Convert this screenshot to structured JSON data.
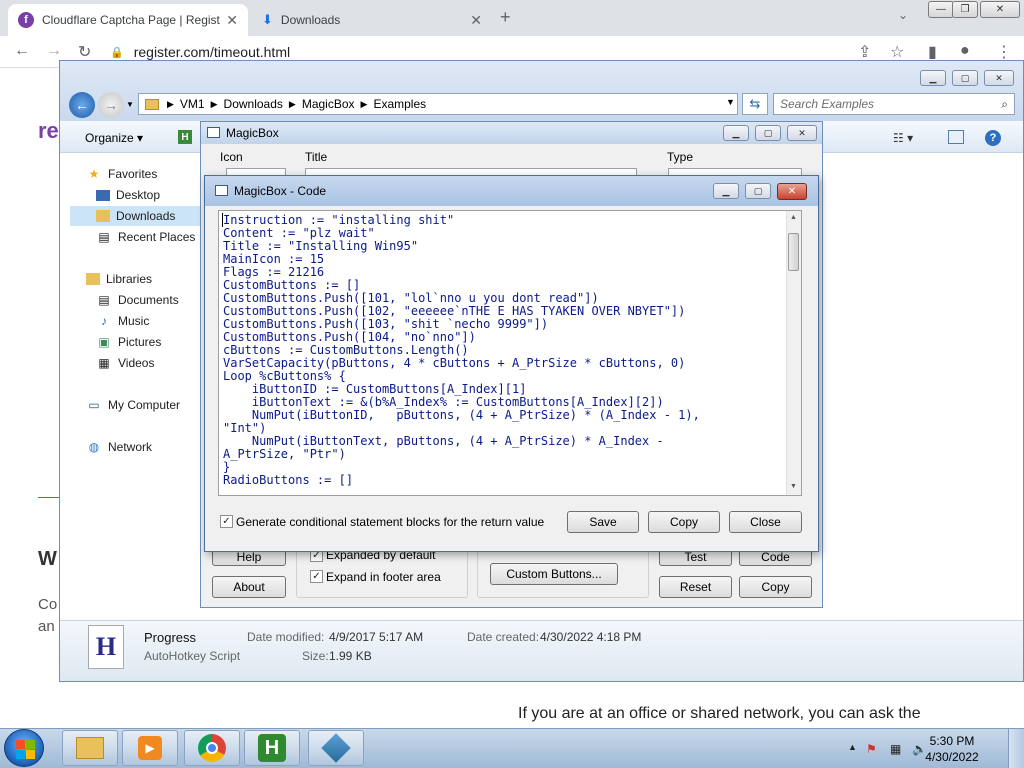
{
  "browser": {
    "tabs": [
      {
        "title": "Cloudflare Captcha Page | Regist",
        "favicon": "f"
      },
      {
        "title": "Downloads",
        "favicon": "download-arrow"
      }
    ],
    "new_tab": "+",
    "url": "register.com/timeout.html"
  },
  "webpage": {
    "logo_fragment": "re",
    "heading_fragment": "W",
    "line1_fragment": "Co",
    "line2_fragment": "an",
    "bottom_text": "If you are at an office or shared network, you can ask the"
  },
  "explorer": {
    "breadcrumb": [
      "VM1",
      "Downloads",
      "MagicBox",
      "Examples"
    ],
    "search_placeholder": "Search Examples",
    "organize_label": "Organize",
    "nav": {
      "favorites": "Favorites",
      "desktop": "Desktop",
      "downloads": "Downloads",
      "recent": "Recent Places",
      "libraries": "Libraries",
      "documents": "Documents",
      "music": "Music",
      "pictures": "Pictures",
      "videos": "Videos",
      "computer": "My Computer",
      "network": "Network"
    },
    "details": {
      "icon_letter": "H",
      "name": "Progress",
      "type": "AutoHotkey Script",
      "modified_label": "Date modified:",
      "modified_value": "4/9/2017 5:17 AM",
      "size_label": "Size:",
      "size_value": "1.99 KB",
      "created_label": "Date created:",
      "created_value": "4/30/2022 4:18 PM"
    }
  },
  "magicbox": {
    "title": "MagicBox",
    "icon_label": "Icon",
    "title_label": "Title",
    "type_label": "Type",
    "help_button": "Help",
    "about_button": "About",
    "expanded_default": "Expanded by default",
    "expand_footer": "Expand in footer area",
    "custom_buttons": "Custom Buttons...",
    "test_button": "Test",
    "code_button": "Code",
    "reset_button": "Reset",
    "copy_button": "Copy"
  },
  "code_dialog": {
    "title": "MagicBox - Code",
    "code_lines": [
      "Instruction := \"installing shit\"",
      "Content := \"plz wait\"",
      "Title := \"Installing Win95\"",
      "MainIcon := 15",
      "Flags := 21216",
      "CustomButtons := []",
      "CustomButtons.Push([101, \"lol`nno u you dont read\"])",
      "CustomButtons.Push([102, \"eeeeee`nTHE E HAS TYAKEN OVER NBYET\"])",
      "CustomButtons.Push([103, \"shit `necho 9999\"])",
      "CustomButtons.Push([104, \"no`nno\"])",
      "cButtons := CustomButtons.Length()",
      "VarSetCapacity(pButtons, 4 * cButtons + A_PtrSize * cButtons, 0)",
      "Loop %cButtons% {",
      "    iButtonID := CustomButtons[A_Index][1]",
      "    iButtonText := &(b%A_Index% := CustomButtons[A_Index][2])",
      "    NumPut(iButtonID,   pButtons, (4 + A_PtrSize) * (A_Index - 1),",
      "\"Int\")",
      "    NumPut(iButtonText, pButtons, (4 + A_PtrSize) * A_Index -",
      "A_PtrSize, \"Ptr\")",
      "}",
      "RadioButtons := []"
    ],
    "checkbox_label": "Generate conditional statement blocks for the return value",
    "save_button": "Save",
    "copy_button": "Copy",
    "close_button": "Close"
  },
  "taskbar": {
    "time": "5:30 PM",
    "date": "4/30/2022"
  }
}
